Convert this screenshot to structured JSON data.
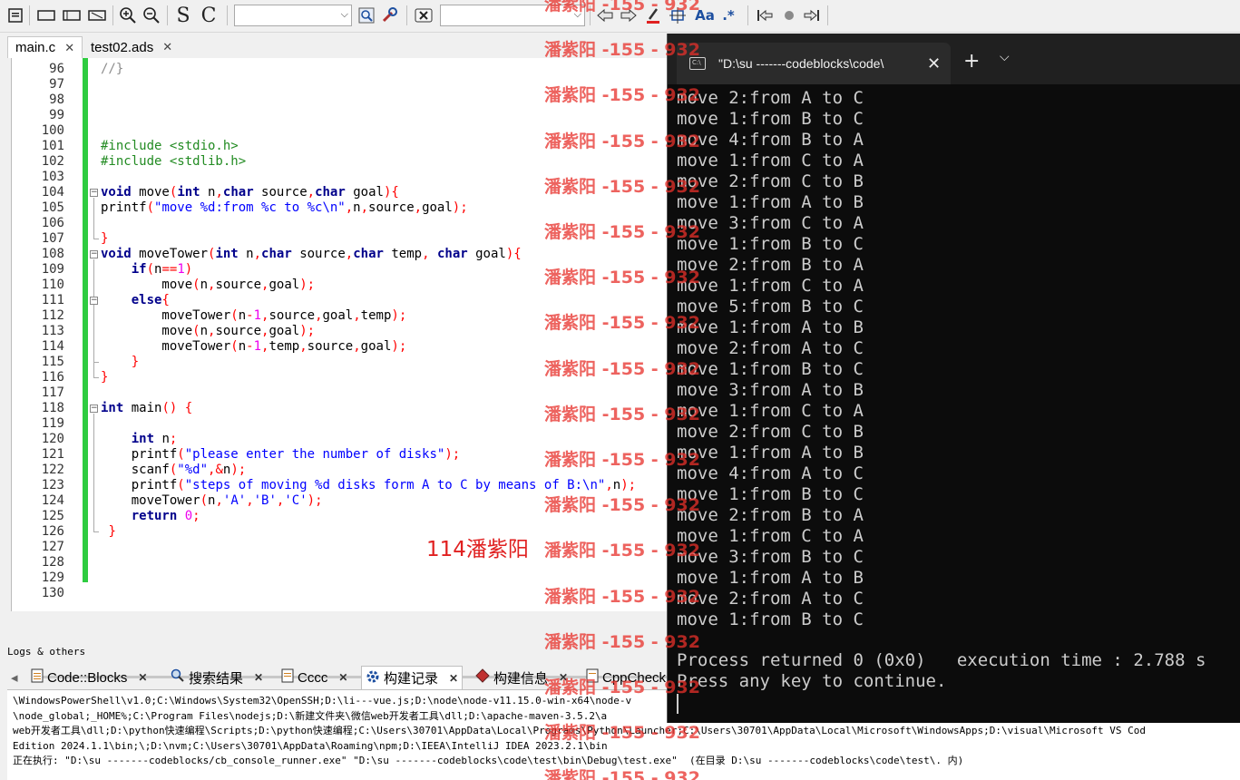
{
  "editor": {
    "tabs": [
      {
        "label": "main.c",
        "active": true
      },
      {
        "label": "test02.ads",
        "active": false
      }
    ],
    "lines": [
      {
        "n": "96",
        "text": "//}"
      },
      {
        "n": "97",
        "text": ""
      },
      {
        "n": "98",
        "text": ""
      },
      {
        "n": "99",
        "text": ""
      },
      {
        "n": "100",
        "text": ""
      },
      {
        "n": "101",
        "text": "#include <stdio.h>"
      },
      {
        "n": "102",
        "text": "#include <stdlib.h>"
      },
      {
        "n": "103",
        "text": ""
      },
      {
        "n": "104",
        "text": "void move(int n,char source,char goal){"
      },
      {
        "n": "105",
        "text": "printf(\"move %d:from %c to %c\\n\",n,source,goal);"
      },
      {
        "n": "106",
        "text": ""
      },
      {
        "n": "107",
        "text": "}"
      },
      {
        "n": "108",
        "text": "void moveTower(int n,char source,char temp, char goal){"
      },
      {
        "n": "109",
        "text": "    if(n==1)"
      },
      {
        "n": "110",
        "text": "        move(n,source,goal);"
      },
      {
        "n": "111",
        "text": "    else{"
      },
      {
        "n": "112",
        "text": "        moveTower(n-1,source,goal,temp);"
      },
      {
        "n": "113",
        "text": "        move(n,source,goal);"
      },
      {
        "n": "114",
        "text": "        moveTower(n-1,temp,source,goal);"
      },
      {
        "n": "115",
        "text": "    }"
      },
      {
        "n": "116",
        "text": "}"
      },
      {
        "n": "117",
        "text": ""
      },
      {
        "n": "118",
        "text": "int main() {"
      },
      {
        "n": "119",
        "text": ""
      },
      {
        "n": "120",
        "text": "    int n;"
      },
      {
        "n": "121",
        "text": "    printf(\"please enter the number of disks\");"
      },
      {
        "n": "122",
        "text": "    scanf(\"%d\",&n);"
      },
      {
        "n": "123",
        "text": "    printf(\"steps of moving %d disks form A to C by means of B:\\n\",n);"
      },
      {
        "n": "124",
        "text": "    moveTower(n,'A','B','C');"
      },
      {
        "n": "125",
        "text": "    return 0;"
      },
      {
        "n": "126",
        "text": " }"
      },
      {
        "n": "127",
        "text": ""
      },
      {
        "n": "128",
        "text": ""
      },
      {
        "n": "129",
        "text": ""
      },
      {
        "n": "130",
        "text": ""
      }
    ]
  },
  "logs": {
    "title": "Logs & others",
    "tabs": [
      {
        "label": "Code::Blocks",
        "icon": "document-icon"
      },
      {
        "label": "搜索结果",
        "icon": "search-icon"
      },
      {
        "label": "Cccc",
        "icon": "document-icon"
      },
      {
        "label": "构建记录",
        "icon": "gear-icon",
        "active": true
      },
      {
        "label": "构建信息",
        "icon": "diamond-icon"
      },
      {
        "label": "CppCheck",
        "icon": "document-icon"
      }
    ],
    "lines": [
      "\\WindowsPowerShell\\v1.0;C:\\Windows\\System32\\OpenSSH;D:\\li---vue.js;D:\\node\\node-v11.15.0-win-x64\\node-v",
      "\\node_global;_HOME%;C:\\Program Files\\nodejs;D:\\新建文件夹\\微信web开发者工具\\dll;D:\\apache-maven-3.5.2\\a",
      "web开发者工具\\dll;D:\\python快速编程\\Scripts;D:\\python快速编程;C:\\Users\\30701\\AppData\\Local\\Programs\\Python\\Launcher;C:\\Users\\30701\\AppData\\Local\\Microsoft\\WindowsApps;D:\\visual\\Microsoft VS Cod",
      "Edition 2024.1.1\\bin;\\;D:\\nvm;C:\\Users\\30701\\AppData\\Roaming\\npm;D:\\IEEA\\IntelliJ IDEA 2023.2.1\\bin",
      "正在执行: \"D:\\su -------codeblocks/cb_console_runner.exe\" \"D:\\su -------codeblocks\\code\\test\\bin\\Debug\\test.exe\"  (在目录 D:\\su -------codeblocks\\code\\test\\. 内)"
    ]
  },
  "terminal": {
    "tab_title": "\"D:\\su -------codeblocks\\code\\",
    "lines": [
      "move 2:from A to C",
      "move 1:from B to C",
      "move 4:from B to A",
      "move 1:from C to A",
      "move 2:from C to B",
      "move 1:from A to B",
      "move 3:from C to A",
      "move 1:from B to C",
      "move 2:from B to A",
      "move 1:from C to A",
      "move 5:from B to C",
      "move 1:from A to B",
      "move 2:from A to C",
      "move 1:from B to C",
      "move 3:from A to B",
      "move 1:from C to A",
      "move 2:from C to B",
      "move 1:from A to B",
      "move 4:from A to C",
      "move 1:from B to C",
      "move 2:from B to A",
      "move 1:from C to A",
      "move 3:from B to C",
      "move 1:from A to B",
      "move 2:from A to C",
      "move 1:from B to C"
    ],
    "status_line": "Process returned 0 (0x0)   execution time : 2.788 s",
    "prompt_line": "Press any key to continue."
  },
  "watermark": {
    "text": "潘紫阳 -155 - 932",
    "signature": "114潘紫阳"
  },
  "colors": {
    "keyword": "#00008b",
    "preprocessor": "#228b22",
    "string": "#0000ff",
    "number": "#ee00ee",
    "change_bar": "#2ecc40",
    "terminal_bg": "#0c0c0c",
    "watermark": "#e8302a"
  }
}
